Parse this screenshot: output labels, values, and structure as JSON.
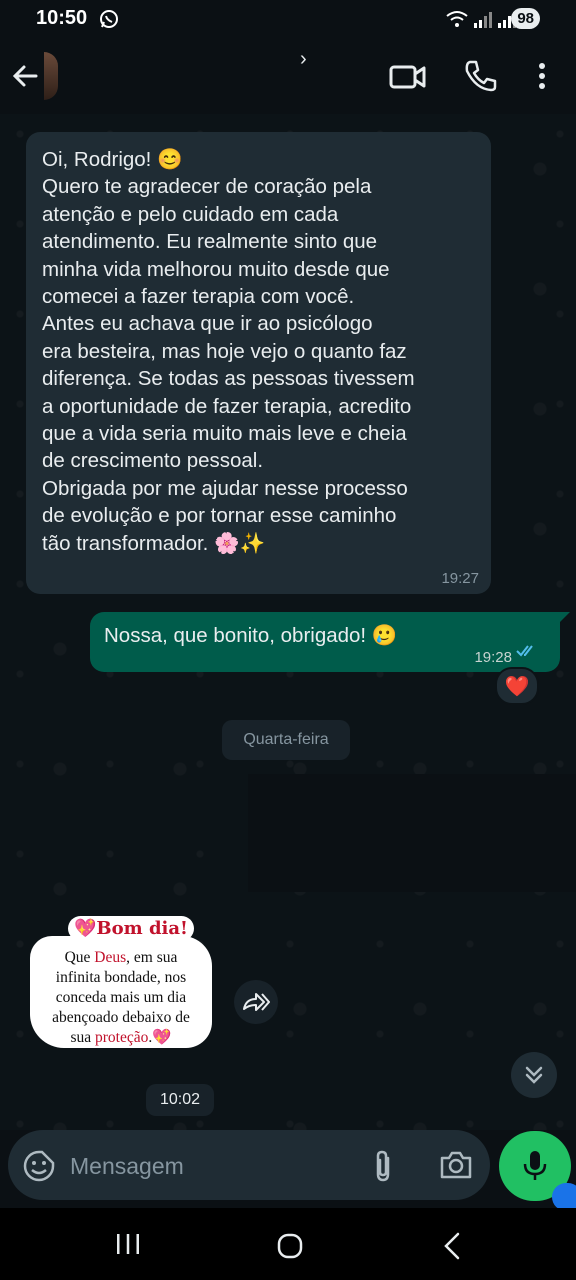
{
  "status_bar": {
    "time": "10:50",
    "battery": "98"
  },
  "header": {
    "contact_name": "›"
  },
  "messages": {
    "msg1": {
      "lines": [
        "Oi, Rodrigo! 😊",
        "Quero te agradecer de coração pela",
        "atenção e pelo cuidado em cada",
        "atendimento. Eu realmente sinto que",
        "minha vida melhorou muito desde que",
        "comecei a fazer terapia com você.",
        "Antes eu achava que ir ao psicólogo",
        "era besteira, mas hoje vejo o quanto faz",
        "diferença. Se todas as pessoas tivessem",
        "a oportunidade de fazer terapia, acredito",
        "que a vida seria muito mais leve e cheia",
        "de crescimento pessoal.",
        "Obrigada por me ajudar nesse processo",
        "de evolução e por tornar esse caminho",
        "tão transformador. 🌸✨"
      ],
      "time": "19:27"
    },
    "msg2": {
      "text": "Nossa, que bonito, obrigado! 🥲",
      "time": "19:28",
      "reaction": "❤️"
    },
    "date_separator": "Quarta-feira",
    "sticker": {
      "title": "💖Bom dia!",
      "line1_a": "Que ",
      "line1_b": "Deus",
      "line1_c": ", em sua",
      "line2": "infinita bondade, nos",
      "line3": "conceda mais um dia",
      "line4": "abençoado debaixo de",
      "line5_a": "sua ",
      "line5_b": "proteção",
      "line5_c": ".💖",
      "time": "10:02"
    }
  },
  "composer": {
    "placeholder": "Mensagem"
  },
  "colors": {
    "incoming_bubble": "#1f2c34",
    "outgoing_bubble": "#005c4b",
    "accent_green": "#21c063",
    "read_ticks": "#53bdeb"
  },
  "icons": [
    "whatsapp-icon",
    "wifi-icon",
    "signal-icon",
    "back-arrow-icon",
    "video-call-icon",
    "phone-icon",
    "more-vert-icon",
    "double-check-icon",
    "heart-icon",
    "forward-icon",
    "double-chevron-down-icon",
    "sticker-icon",
    "attach-icon",
    "camera-icon",
    "mic-icon",
    "recent-apps-icon",
    "home-icon",
    "back-icon"
  ]
}
